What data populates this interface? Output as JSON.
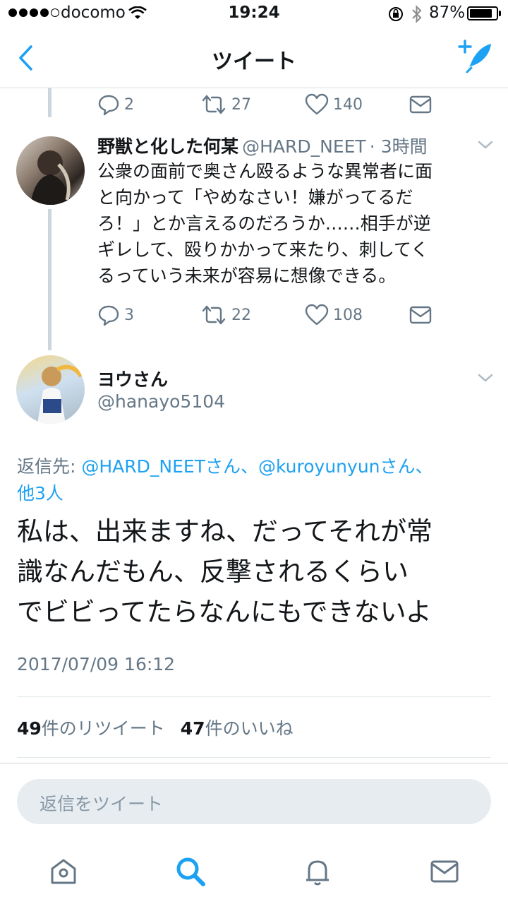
{
  "status_bar": {
    "carrier": "docomo",
    "time": "19:24",
    "battery": "87%",
    "battery_level": 0.87
  },
  "nav": {
    "title": "ツイート",
    "back_icon": "chevron-left-icon",
    "compose_icon": "compose-tweet-icon"
  },
  "tweet_prev_actions": {
    "replies": "2",
    "retweets": "27",
    "likes": "140"
  },
  "tweet_mid": {
    "name": "野獣と化した何某",
    "handle": "@HARD_NEET",
    "time": "· 3時間",
    "text_lines": [
      "公衆の面前で奥さん殴るような異常者に面",
      "と向かって「やめなさい！嫌がってるだ",
      "ろ！」とか言えるのだろうか……相手が逆",
      "ギレして、殴りかかって来たり、刺してく",
      "るっていう未来が容易に想像できる。"
    ],
    "replies": "3",
    "retweets": "22",
    "likes": "108"
  },
  "main_tweet": {
    "name": "ヨウさん",
    "handle": "@hanayo5104",
    "reply_prefix": "返信先: ",
    "reply_to_1": "@HARD_NEETさん、@kuroyunyunさん、",
    "reply_to_2": "他3人",
    "text_lines": [
      "私は、出来ますね、だってそれが常",
      "識なんだもん、反撃されるくらい",
      "でビビってたらなんにもできないよ"
    ],
    "timestamp": "2017/07/09 16:12",
    "retweet_count": "49",
    "retweet_label": "件のリツイート",
    "like_count": "47",
    "like_label": "件のいいね"
  },
  "reply_box": {
    "placeholder": "返信をツイート"
  },
  "tabbar": {
    "items": [
      "home-icon",
      "search-icon",
      "notifications-icon",
      "messages-icon"
    ]
  },
  "colors": {
    "accent": "#1da1f2",
    "muted": "#657786",
    "text": "#14171a"
  }
}
